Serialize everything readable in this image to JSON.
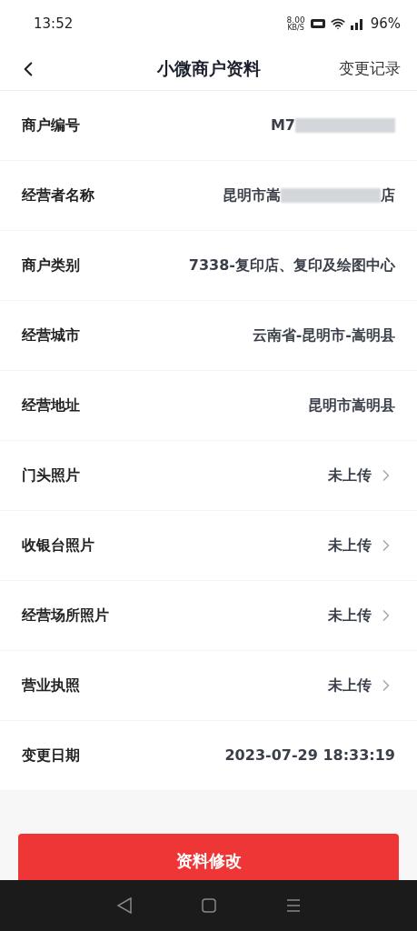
{
  "status_bar": {
    "time": "13:52",
    "speed": "8.00",
    "speed_unit": "KB/S",
    "battery": "96%"
  },
  "header": {
    "title": "小微商户资料",
    "action": "变更记录"
  },
  "rows": [
    {
      "label": "商户编号",
      "value": [
        {
          "kind": "text",
          "text": "M7"
        },
        {
          "kind": "blur"
        }
      ],
      "link": false
    },
    {
      "label": "经营者名称",
      "value": [
        {
          "kind": "text",
          "text": "昆明市嵩"
        },
        {
          "kind": "blur"
        },
        {
          "kind": "text",
          "text": "店"
        }
      ],
      "link": false
    },
    {
      "label": "商户类别",
      "value": [
        {
          "kind": "text",
          "text": "7338-复印店、复印及绘图中心"
        }
      ],
      "link": false
    },
    {
      "label": "经营城市",
      "value": [
        {
          "kind": "text",
          "text": "云南省-昆明市-嵩明县"
        }
      ],
      "link": false
    },
    {
      "label": "经营地址",
      "value": [
        {
          "kind": "text",
          "text": "昆明市嵩明县"
        }
      ],
      "link": false
    },
    {
      "label": "门头照片",
      "value": [
        {
          "kind": "text",
          "text": "未上传"
        }
      ],
      "link": true
    },
    {
      "label": "收银台照片",
      "value": [
        {
          "kind": "text",
          "text": "未上传"
        }
      ],
      "link": true
    },
    {
      "label": "经营场所照片",
      "value": [
        {
          "kind": "text",
          "text": "未上传"
        }
      ],
      "link": true
    },
    {
      "label": "营业执照",
      "value": [
        {
          "kind": "text",
          "text": "未上传"
        }
      ],
      "link": true
    },
    {
      "label": "变更日期",
      "value": [
        {
          "kind": "text",
          "text": "2023-07-29 18:33:19"
        }
      ],
      "link": false
    }
  ],
  "button": "资料修改"
}
